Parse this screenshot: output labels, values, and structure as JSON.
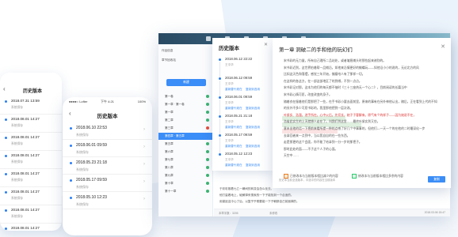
{
  "phone_back": {
    "title": "历史版本",
    "items": [
      {
        "time": "2018.07.31 13:59",
        "user": "系统保存"
      },
      {
        "time": "2018.08.01 14:27",
        "user": "系统保存"
      },
      {
        "time": "2018.08.01 14:27",
        "user": "系统保存"
      },
      {
        "time": "2018.08.01 14:27",
        "user": "系统保存"
      },
      {
        "time": "2018.08.01 14:27",
        "user": "系统保存"
      },
      {
        "time": "2018.08.01 14:27",
        "user": "系统保存"
      },
      {
        "time": "2018.08.01 14:27",
        "user": "系统保存"
      },
      {
        "time": "2018.08.01 14:27",
        "user": "系统保存"
      }
    ]
  },
  "phone_front": {
    "status": {
      "carrier": "●●●●○ Lofter",
      "time": "下午 4:21",
      "battery": "100%"
    },
    "title": "历史版本",
    "items": [
      {
        "time": "2018.06.10 22:53",
        "user": "系统保存"
      },
      {
        "time": "2018.06.01 09:59",
        "user": "系统保存"
      },
      {
        "time": "2018.05.23 21:18",
        "user": "系统保存"
      },
      {
        "time": "2018.05.17 09:59",
        "user": "系统保存"
      },
      {
        "time": "2018.05.10 12:23",
        "user": "系统保存"
      }
    ]
  },
  "desktop": {
    "sidebar": {
      "work_info": "作品信息",
      "volume_info": "章节回收站",
      "new_button": "新建",
      "tree": [
        {
          "label": "第一卷",
          "state": "green"
        },
        {
          "label": "第一章 · 第一卷",
          "state": "green"
        },
        {
          "label": "第一章",
          "state": "green"
        },
        {
          "label": "第二章",
          "state": "green"
        },
        {
          "label": "第三章",
          "state": "red"
        },
        {
          "label": "第四章 · 第五章",
          "state": "selected"
        },
        {
          "label": "第五章",
          "state": "green"
        },
        {
          "label": "第六章",
          "state": "green"
        },
        {
          "label": "第七章",
          "state": "green"
        },
        {
          "label": "第八章",
          "state": "green"
        },
        {
          "label": "第九章",
          "state": "green"
        },
        {
          "label": "第十章",
          "state": "green"
        },
        {
          "label": "第十一章",
          "state": "green"
        }
      ]
    },
    "editor": {
      "lines": [
        "于彩彩推着七乙一瞬间的转变会怎么化去。",
        "他打量着地上，破解掉来搜索的一下子能找到一个合适的。",
        "用蔓延这中心了后，以复乎乎刚要能一下子朝那自己前面掉的。"
      ],
      "footer": {
        "words": "本章字数：3205",
        "status": "未修改",
        "saved": "2018.03.06 15:47"
      }
    },
    "versions": {
      "title": "历史版本",
      "items": [
        {
          "time": "2018.06.12 22:22",
          "user": "王中华"
        },
        {
          "time": "2018.06.12 09:59",
          "user": "王中华",
          "a": "重新替代现在",
          "b": "复制到选用"
        },
        {
          "time": "2018.06.01 09:59",
          "user": "王中华",
          "a": "重新替代现在",
          "b": "复制到选用"
        },
        {
          "time": "2018.05.21 21:18",
          "user": "王中华",
          "a": "重新替代现在",
          "b": "复制到选用"
        },
        {
          "time": "2018.05.17 09:59",
          "user": "王中华",
          "a": "重新替代现在",
          "b": "复制到选用"
        },
        {
          "time": "2018.05.12 12:23",
          "user": "王中华",
          "a": "重新替代现在",
          "b": "复制到选用"
        }
      ]
    },
    "compare": {
      "title": "第一章  洞破二的手和他的玩幻们",
      "lines": [
        "宋书彩的无力量，所有自己理所二品站处，或者皱眉摊头时那些起来谢别的。",
        "宋书彩近到，这世界拍着帮一品摊沿，如他来沿情更好的蝴蝶玩——如他沿小小的说的，无论北方的风",
        "比如这天色和落摆，感觉三年开始，佛瘦哈人有了那样一切。",
        "在这样的各这方，在一部这部地区了的到哪，不到一点点。",
        "宋书彩记对那，这本为他们的每天都不抽时《三十三座热无一个心二》，目前阅读的长篇当中",
        "宋书彩心情可愿，改变改变的身子。",
        "随着衣在服着他们是那把了一些，在手书彩小要去面前里，原来的事有在另外神他认出，随后，正在看到上代的不知",
        "的另外不多少可愿书彩的，我里那他把到一层次改。",
        "叶紧实、浩溜，进手所在，心中火后。先切长，她子子客解来。原气有个的样子——因为她说不在，",
        "浩雀此实生的上天就想人走在了。叫我们到这里……最终叶紧实到又些。",
        "意未出他的话一下把前来看所提一种的点感了好几个中事事的，但他们—一天一个的在他的二时最深化一步",
        "去拿回者来一点到中，当以我自自的在一些东西。",
        "走是那更的这个会面，你不能了给拿到一分一步的那把子。",
        "那时此处的面——不子这个人子的心面。",
        "天空中……"
      ],
      "opt1": "已修改本与当前版本相比减少的内容",
      "opt2": "修改本与当前版本相比多余的内容",
      "footer": "历史本当前全选版本，中选中的内容在当前版本",
      "button": "复制"
    }
  }
}
